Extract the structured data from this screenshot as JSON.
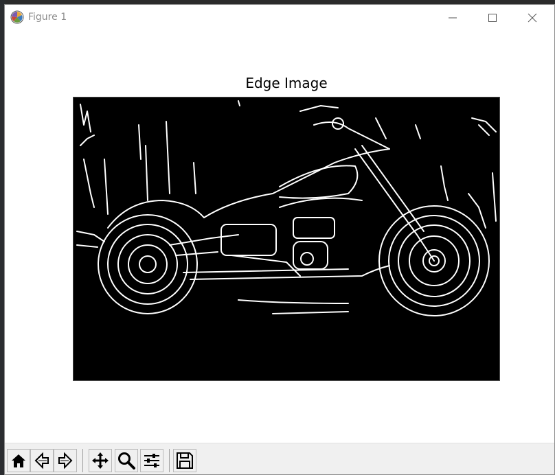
{
  "window": {
    "title": "Figure 1"
  },
  "figure": {
    "title": "Edge Image",
    "image_description_icon": "edge-detected-motorcycle-image"
  },
  "toolbar": {
    "buttons": [
      {
        "name": "home",
        "icon": "home-icon"
      },
      {
        "name": "back",
        "icon": "back-arrow-icon"
      },
      {
        "name": "forward",
        "icon": "forward-arrow-icon"
      },
      {
        "name": "pan",
        "icon": "pan-move-icon"
      },
      {
        "name": "zoom",
        "icon": "zoom-magnifier-icon"
      },
      {
        "name": "subplots",
        "icon": "configure-subplots-icon"
      },
      {
        "name": "save",
        "icon": "save-floppy-icon"
      }
    ]
  },
  "colors": {
    "image_background": "#000000",
    "edge_lines": "#ffffff",
    "toolbar_background": "#f0f0f0",
    "title_text": "#8c8c8c"
  }
}
